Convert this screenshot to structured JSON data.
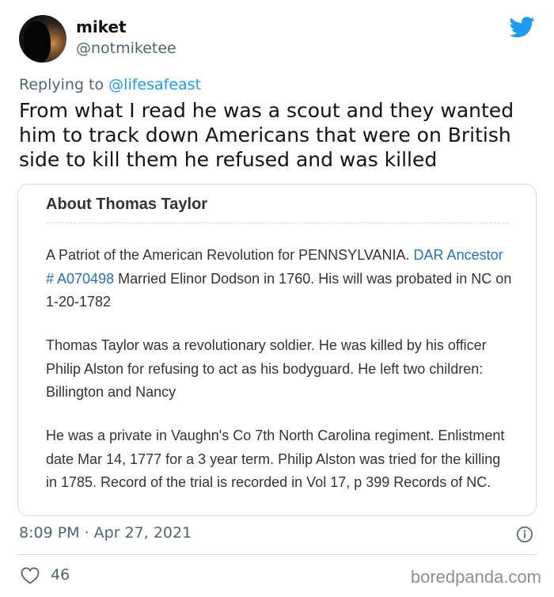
{
  "author": {
    "display_name": "miket",
    "handle": "@notmiketee"
  },
  "icons": {
    "brand": "twitter-bird-icon",
    "info": "info-icon",
    "like": "heart-icon"
  },
  "colors": {
    "accent": "#1d9bf0",
    "secondary_text": "#536471",
    "card_link": "#2672b8"
  },
  "reply": {
    "prefix": "Replying to",
    "mention": "@lifesafeast"
  },
  "tweet": {
    "text": "From what I read he was a scout and they wanted him to track down Americans that were on British side to kill them he refused and was killed"
  },
  "card": {
    "title": "About Thomas Taylor",
    "p1_before_link": "A Patriot of the American Revolution for PENNSYLVANIA. ",
    "p1_link": "DAR Ancestor # A070498",
    "p1_after_link": " Married Elinor Dodson in 1760. His will was probated in NC on 1-20-1782",
    "p2": "Thomas Taylor was a revolutionary soldier. He was killed by his officer Philip Alston for refusing to act as his bodyguard. He left two children: Billington and Nancy",
    "p3": "He was a private in Vaughn's Co 7th North Carolina regiment. Enlistment date Mar 14, 1777 for a 3 year term. Philip Alston was tried for the killing in 1785. Record of the trial is recorded in Vol 17, p 399 Records of NC."
  },
  "meta": {
    "timestamp": "8:09 PM · Apr 27, 2021",
    "likes": "46"
  },
  "watermark": "boredpanda.com"
}
